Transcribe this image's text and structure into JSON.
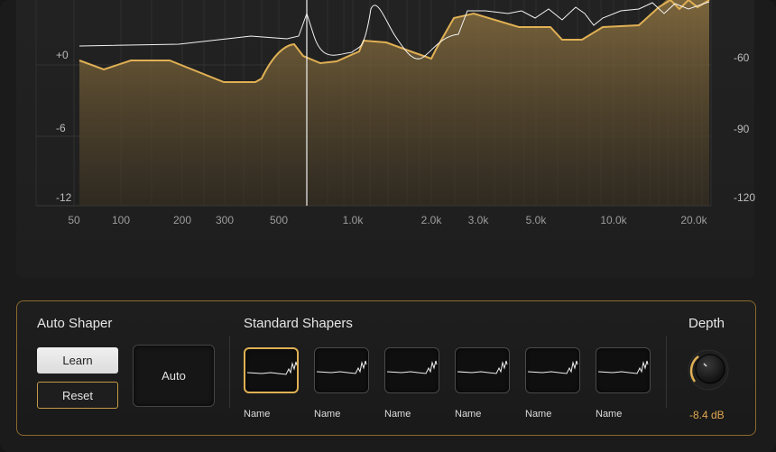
{
  "display": {
    "left_axis": [
      "+0",
      "-6",
      "-12"
    ],
    "right_axis": [
      "-60",
      "-90",
      "-120"
    ],
    "freq_labels": [
      "50",
      "100",
      "200",
      "300",
      "500",
      "1.0k",
      "2.0k",
      "3.0k",
      "5.0k",
      "10.0k",
      "20.0k"
    ],
    "accent_color": "#e0b054"
  },
  "auto_shaper": {
    "title": "Auto Shaper",
    "learn_label": "Learn",
    "reset_label": "Reset",
    "auto_label": "Auto"
  },
  "standard_shapers": {
    "title": "Standard Shapers",
    "items": [
      {
        "name": "Name",
        "selected": true
      },
      {
        "name": "Name",
        "selected": false
      },
      {
        "name": "Name",
        "selected": false
      },
      {
        "name": "Name",
        "selected": false
      },
      {
        "name": "Name",
        "selected": false
      },
      {
        "name": "Name",
        "selected": false
      }
    ]
  },
  "depth": {
    "title": "Depth",
    "value": "-8.4 dB"
  }
}
